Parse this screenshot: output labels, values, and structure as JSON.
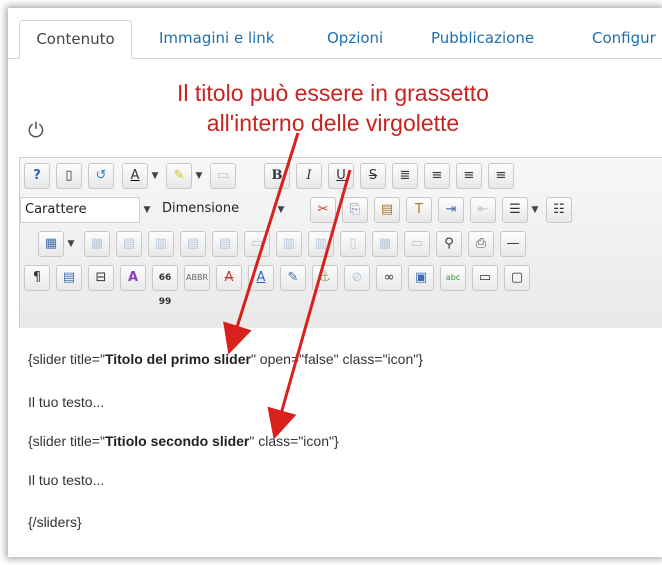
{
  "tabs": [
    "Contenuto",
    "Immagini e link",
    "Opzioni",
    "Pubblicazione",
    "Configur"
  ],
  "annotation": {
    "line1": "Il titolo può essere in grassetto",
    "line2": "all'interno delle virgolette",
    "color": "#c8231f"
  },
  "power_icon": "⏻",
  "toolbar": {
    "font_select": "Carattere",
    "size_select": "Dimensione",
    "bold": "B",
    "italic": "I",
    "underline": "U",
    "strike": "S",
    "pilcrow": "¶",
    "quotes": "66 99",
    "abbr": "ABBR",
    "abc": "abc"
  },
  "content": {
    "line1_pre": "{slider title=\"",
    "line1_bold": "Titolo del primo slider",
    "line1_post": "\" open=\"false\" class=\"icon\"}",
    "line2": "Il tuo testo...",
    "line3_pre": "{slider title=\"",
    "line3_bold": "Titiolo secondo slider",
    "line3_post": "\" class=\"icon\"}",
    "line4": "Il tuo testo...",
    "line5": "{/sliders}"
  }
}
